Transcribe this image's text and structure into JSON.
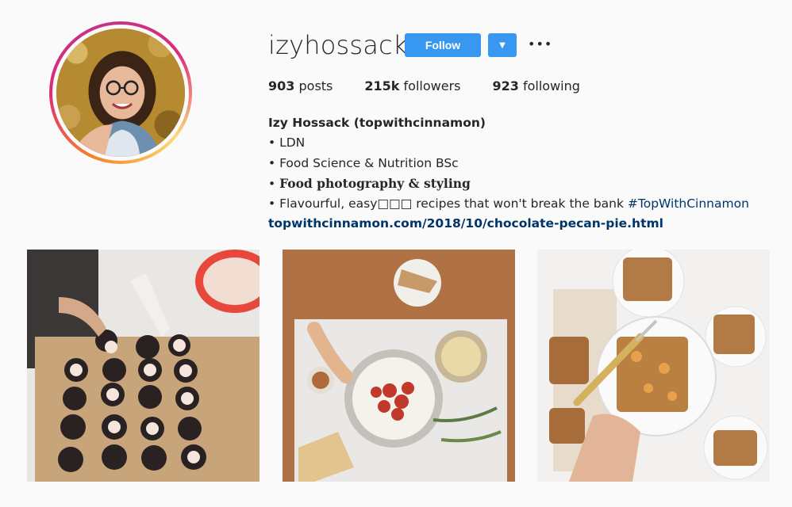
{
  "profile": {
    "username": "izyhossack",
    "follow_label": "Follow",
    "dropdown_glyph": "▼",
    "more_glyph": "•••",
    "stats": {
      "posts_count": "903",
      "posts_label": "posts",
      "followers_count": "215k",
      "followers_label": "followers",
      "following_count": "923",
      "following_label": "following"
    },
    "bio": {
      "full_name": "Izy Hossack (topwithcinnamon)",
      "line1": "• LDN",
      "line2": "• Food Science & Nutrition BSc",
      "line3_bullet": "• ",
      "line3_text": "Food photography & styling",
      "line4_prefix": "• Flavourful, easy□□□ recipes that won't break the bank ",
      "line4_hashtag": "#TopWithCinnamon",
      "website": "topwithcinnamon.com/2018/10/chocolate-pecan-pie.html"
    }
  },
  "colors": {
    "accent": "#3897f0",
    "link": "#003569",
    "background": "#fafafa"
  },
  "icons": {
    "dropdown": "chevron-down-icon",
    "more": "more-options-icon"
  },
  "posts": [
    {
      "name": "post-cookies"
    },
    {
      "name": "post-hummus-spread"
    },
    {
      "name": "post-crumble-bars"
    }
  ]
}
